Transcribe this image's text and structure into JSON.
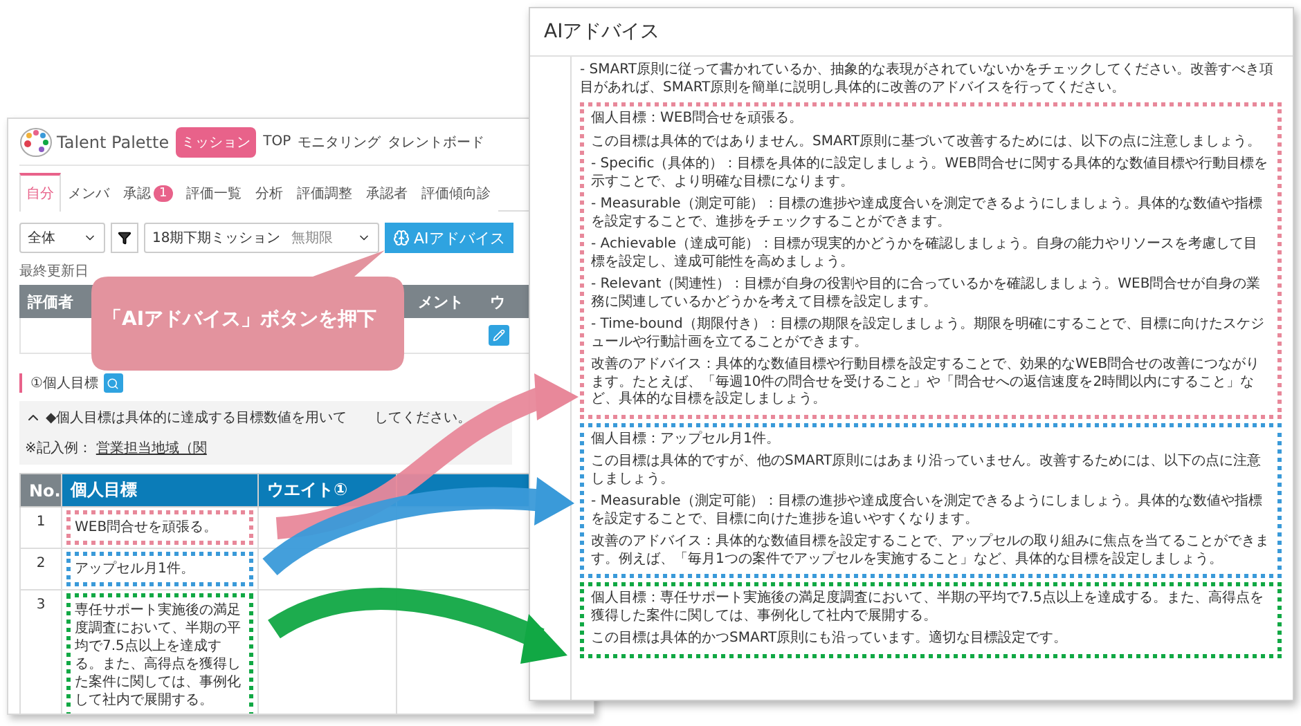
{
  "left_window": {
    "logo": "Talent Palette",
    "mission_button": "ミッション",
    "nav": [
      "TOP",
      "モニタリング",
      "タレントボード"
    ],
    "tabs": [
      {
        "label": "自分",
        "selected": true
      },
      {
        "label": "メンバ",
        "selected": false
      },
      {
        "label": "承認",
        "selected": false,
        "badge": "1"
      },
      {
        "label": "評価一覧",
        "selected": false
      },
      {
        "label": "分析",
        "selected": false
      },
      {
        "label": "評価調整",
        "selected": false
      },
      {
        "label": "承認者",
        "selected": false
      },
      {
        "label": "評価傾向診",
        "selected": false
      }
    ],
    "filters": {
      "scope": "全体",
      "period": "18期下期ミッション",
      "period_note": "無期限",
      "ai_button": "AIアドバイス"
    },
    "last_updated_label": "最終更新日",
    "evaluator_table": {
      "columns": [
        "評価者",
        "メント",
        "ウ"
      ]
    },
    "section_title": "①個人目標",
    "guide": {
      "expanded": true,
      "text_before": "◆個人目標は具体的に達成する目標数値を用いて",
      "text_after": "してください。",
      "example_label": "※記入例：",
      "example_link": "営業担当地域（関"
    },
    "goals_table": {
      "columns": [
        "No.",
        "個人目標",
        "ウエイト①"
      ],
      "rows": [
        {
          "no": "1",
          "goal": "WEB問合せを頑張る。",
          "color": "#e8889a"
        },
        {
          "no": "2",
          "goal": "アップセル月1件。",
          "color": "#3a9ad9"
        },
        {
          "no": "3",
          "goal": "専任サポート実施後の満足度調査において、半期の平均で7.5点以上を達成する。また、高得点を獲得した案件に関しては、事例化して社内で展開する。",
          "color": "#11a844"
        }
      ]
    }
  },
  "callout": {
    "text": "「AIアドバイス」ボタンを押下"
  },
  "ai_window": {
    "title": "AIアドバイス",
    "intro": "- SMART原則に従って書かれているか、抽象的な表現がされていないかをチェックしてください。改善すべき項目があれば、SMART原則を簡単に説明し具体的に改善のアドバイスを行ってください。",
    "blocks": [
      {
        "color": "#e8889a",
        "paragraphs": [
          "個人目標：WEB問合せを頑張る。",
          "この目標は具体的ではありません。SMART原則に基づいて改善するためには、以下の点に注意しましょう。",
          "- Specific（具体的）：目標を具体的に設定しましょう。WEB問合せに関する具体的な数値目標や行動目標を示すことで、より明確な目標になります。",
          "- Measurable（測定可能）：目標の進捗や達成度合いを測定できるようにしましょう。具体的な数値や指標を設定することで、進捗をチェックすることができます。",
          "- Achievable（達成可能）：目標が現実的かどうかを確認しましょう。自身の能力やリソースを考慮して目標を設定し、達成可能性を高めましょう。",
          "- Relevant（関連性）：目標が自身の役割や目的に合っているかを確認しましょう。WEB問合せが自身の業務に関連しているかどうかを考えて目標を設定します。",
          "- Time-bound（期限付き）：目標の期限を設定しましょう。期限を明確にすることで、目標に向けたスケジュールや行動計画を立てることができます。",
          "改善のアドバイス：具体的な数値目標や行動目標を設定することで、効果的なWEB問合せの改善につながります。たとえば、「毎週10件の問合せを受けること」や「問合せへの返信速度を2時間以内にすること」など、具体的な目標を設定しましょう。"
        ]
      },
      {
        "color": "#3a9ad9",
        "paragraphs": [
          "個人目標：アップセル月1件。",
          "この目標は具体的ですが、他のSMART原則にはあまり沿っていません。改善するためには、以下の点に注意しましょう。",
          "- Measurable（測定可能）：目標の進捗や達成度合いを測定できるようにしましょう。具体的な数値や指標を設定することで、目標に向けた進捗を追いやすくなります。",
          "改善のアドバイス：具体的な数値目標を設定することで、アップセルの取り組みに焦点を当てることができます。例えば、「毎月1つの案件でアップセルを実施すること」など、具体的な目標を設定しましょう。"
        ]
      },
      {
        "color": "#11a844",
        "paragraphs": [
          "個人目標：専任サポート実施後の満足度調査において、半期の平均で7.5点以上を達成する。また、高得点を獲得した案件に関しては、事例化して社内で展開する。",
          "この目標は具体的かつSMART原則にも沿っています。適切な目標設定です。"
        ]
      }
    ]
  }
}
